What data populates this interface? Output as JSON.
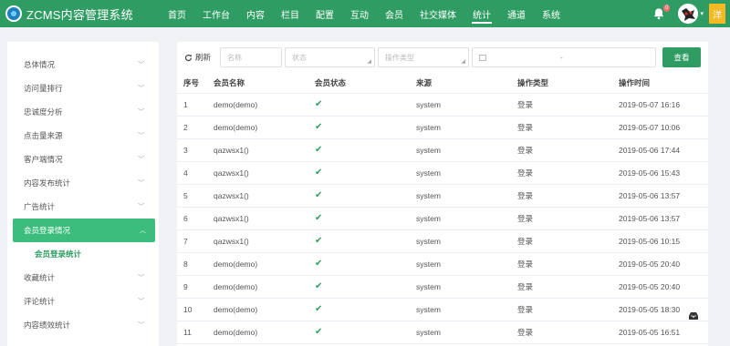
{
  "app": {
    "logo_text": "ZCMS内容管理系统"
  },
  "nav": [
    {
      "label": "首页"
    },
    {
      "label": "工作台"
    },
    {
      "label": "内容"
    },
    {
      "label": "栏目"
    },
    {
      "label": "配置"
    },
    {
      "label": "互动"
    },
    {
      "label": "会员"
    },
    {
      "label": "社交媒体"
    },
    {
      "label": "统计"
    },
    {
      "label": "通道"
    },
    {
      "label": "系统"
    }
  ],
  "nav_active": "统计",
  "header": {
    "notification_count": "0",
    "user_badge": "洋"
  },
  "sidebar": {
    "items": [
      {
        "label": "总体情况"
      },
      {
        "label": "访问量排行"
      },
      {
        "label": "忠诚度分析"
      },
      {
        "label": "点击量来源"
      },
      {
        "label": "客户端情况"
      },
      {
        "label": "内容发布统计"
      },
      {
        "label": "广告统计"
      },
      {
        "label": "会员登录情况"
      }
    ],
    "sub_item": {
      "label": "会员登录统计"
    },
    "items_after": [
      {
        "label": "收藏统计"
      },
      {
        "label": "评论统计"
      },
      {
        "label": "内容绩效统计"
      }
    ]
  },
  "toolbar": {
    "refresh_label": "刷新",
    "name_placeholder": "名称",
    "status_placeholder": "状态",
    "type_placeholder": "操作类型",
    "date_separator": "-",
    "search_label": "查看"
  },
  "table": {
    "headers": [
      "序号",
      "会员名称",
      "会员状态",
      "来源",
      "操作类型",
      "操作时间"
    ],
    "rows": [
      {
        "no": "1",
        "name": "demo(demo)",
        "source": "system",
        "type": "登录",
        "time": "2019-05-07 16:16"
      },
      {
        "no": "2",
        "name": "demo(demo)",
        "source": "system",
        "type": "登录",
        "time": "2019-05-07 10:06"
      },
      {
        "no": "3",
        "name": "qazwsx1()",
        "source": "system",
        "type": "登录",
        "time": "2019-05-06 17:44"
      },
      {
        "no": "4",
        "name": "qazwsx1()",
        "source": "system",
        "type": "登录",
        "time": "2019-05-06 15:43"
      },
      {
        "no": "5",
        "name": "qazwsx1()",
        "source": "system",
        "type": "登录",
        "time": "2019-05-06 13:57"
      },
      {
        "no": "6",
        "name": "qazwsx1()",
        "source": "system",
        "type": "登录",
        "time": "2019-05-06 13:57"
      },
      {
        "no": "7",
        "name": "qazwsx1()",
        "source": "system",
        "type": "登录",
        "time": "2019-05-06 10:15"
      },
      {
        "no": "8",
        "name": "demo(demo)",
        "source": "system",
        "type": "登录",
        "time": "2019-05-05 20:40"
      },
      {
        "no": "9",
        "name": "demo(demo)",
        "source": "system",
        "type": "登录",
        "time": "2019-05-05 20:40"
      },
      {
        "no": "10",
        "name": "demo(demo)",
        "source": "system",
        "type": "登录",
        "time": "2019-05-05 18:30"
      },
      {
        "no": "11",
        "name": "demo(demo)",
        "source": "system",
        "type": "登录",
        "time": "2019-05-05 16:51"
      }
    ],
    "status_icon": "check-icon"
  },
  "colors": {
    "brand": "#2f9d63",
    "active_menu": "#3dbd7d",
    "badge": "#f5b923"
  }
}
